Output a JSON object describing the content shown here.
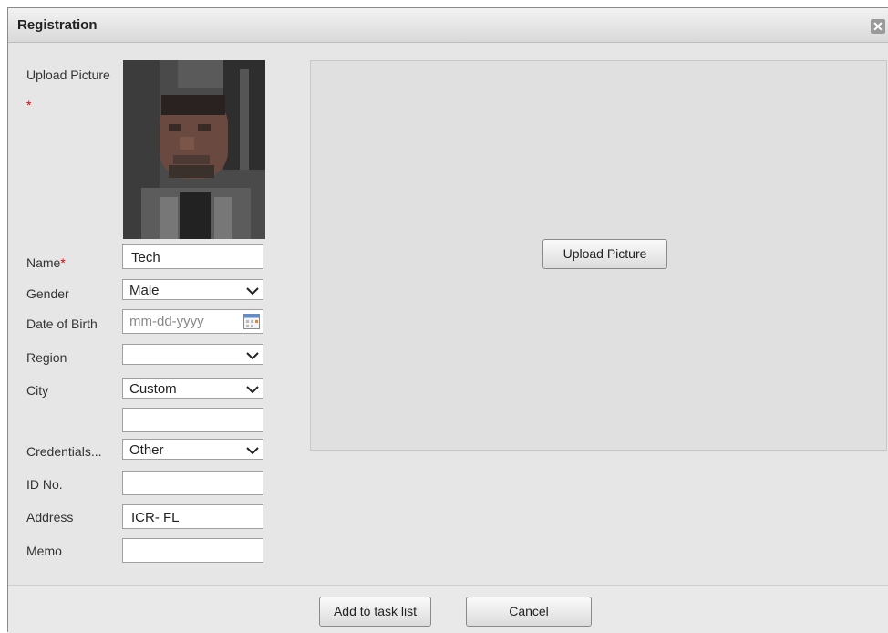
{
  "dialog": {
    "title": "Registration",
    "close_symbol": "✕"
  },
  "form": {
    "upload_picture_label": "Upload Picture",
    "upload_required_mark": "*",
    "name_label": "Name",
    "name_required_mark": "*",
    "name_value": "Tech",
    "gender_label": "Gender",
    "gender_value": "Male",
    "dob_label": "Date of Birth",
    "dob_placeholder": "mm-dd-yyyy",
    "region_label": "Region",
    "region_value": "",
    "city_label": "City",
    "city_value": "Custom",
    "city_custom_value": "",
    "credentials_label": "Credentials...",
    "credentials_value": "Other",
    "id_label": "ID No.",
    "id_value": "",
    "address_label": "Address",
    "address_value": "ICR- FL",
    "memo_label": "Memo",
    "memo_value": ""
  },
  "upload_area": {
    "button_label": "Upload Picture"
  },
  "footer": {
    "add_button_label": "Add to task list",
    "cancel_button_label": "Cancel"
  },
  "icons": {
    "close": "close-icon",
    "dropdown": "chevron-down-icon",
    "calendar": "calendar-icon",
    "photo": "face-photo"
  }
}
